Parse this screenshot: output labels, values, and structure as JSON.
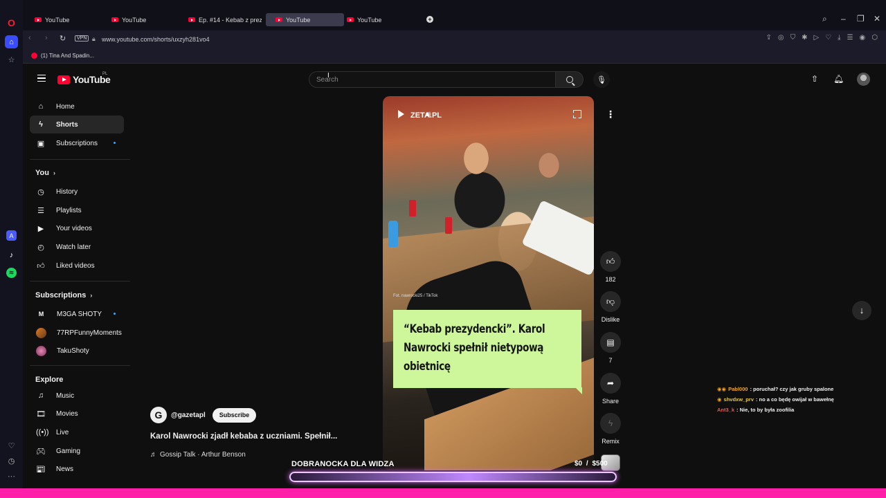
{
  "browser": {
    "tabs": [
      {
        "label": "YouTube"
      },
      {
        "label": "YouTube"
      },
      {
        "label": "Ep. #14 - Kebab z prezyde"
      },
      {
        "label": "YouTube"
      },
      {
        "label": "YouTube"
      }
    ],
    "url": "www.youtube.com/shorts/uxzyh281vo4",
    "vpn_label": "VPN",
    "bookmark": "(1) Tina And Spadin..."
  },
  "header": {
    "logo_text": "YouTube",
    "region": "PL",
    "search_placeholder": "Search"
  },
  "sidebar": {
    "main": [
      {
        "label": "Home",
        "icon": "home-icon"
      },
      {
        "label": "Shorts",
        "icon": "shorts-icon"
      },
      {
        "label": "Subscriptions",
        "icon": "subscriptions-icon"
      }
    ],
    "you": {
      "heading": "You",
      "items": [
        {
          "label": "History"
        },
        {
          "label": "Playlists"
        },
        {
          "label": "Your videos"
        },
        {
          "label": "Watch later"
        },
        {
          "label": "Liked videos"
        }
      ]
    },
    "subscriptions": {
      "heading": "Subscriptions",
      "items": [
        {
          "label": "M3GA SHOTY",
          "avatar_letter": "M"
        },
        {
          "label": "77RPFunnyMoments"
        },
        {
          "label": "TakuShoty"
        }
      ]
    },
    "explore": {
      "heading": "Explore",
      "items": [
        {
          "label": "Music"
        },
        {
          "label": "Movies"
        },
        {
          "label": "Live"
        },
        {
          "label": "Gaming"
        },
        {
          "label": "News"
        }
      ]
    }
  },
  "short": {
    "watermark": "ZETA.PL",
    "credit": "Fot. nawrocki25 / TikTok",
    "headline": "“Kebab prezydencki”. Karol Nawrocki spełnił nietypową obietnicę",
    "channel_handle": "@gazetapl",
    "channel_logo": "G",
    "subscribe_label": "Subscribe",
    "title": "Karol Nawrocki zjadł kebaba z uczniami. Spełnił...",
    "audio": "Gossip Talk · Arthur Benson"
  },
  "actions": {
    "like_count": "182",
    "dislike_label": "Dislike",
    "comment_count": "7",
    "share_label": "Share",
    "remix_label": "Remix"
  },
  "overlay": {
    "chat": [
      {
        "user": "Pabl000",
        "message": ": poruchał? czy jak gruby spalone",
        "user_color": "#f5a623"
      },
      {
        "user": "shvdxw_prv",
        "message": ": no a co będę owijał w bawełnę",
        "user_color": "#e6c84a"
      },
      {
        "user": "Ant3_k",
        "message": ": Nie, to by była zoofilia",
        "user_color": "#e05a5a"
      }
    ],
    "goal_label": "DOBRANOCKA DLA WIDZA",
    "goal_amount": "$0 / $500",
    "goal_progress": 0
  },
  "colors": {
    "accent": "#ff0033",
    "goal_bar": "#c088ff",
    "headline_bg": "#cdf79a",
    "bottom_strip": "#ff1fa9"
  }
}
